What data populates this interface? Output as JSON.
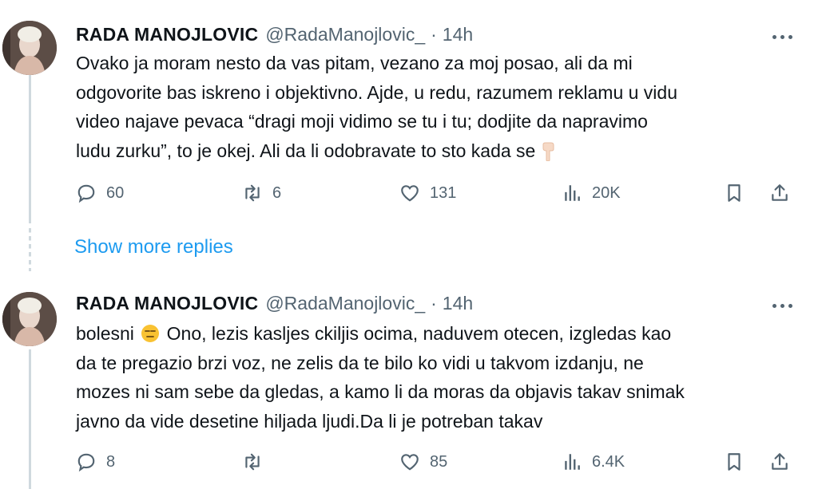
{
  "tweets": [
    {
      "author_name": "RADA MANOJLOVIC",
      "handle": "@RadaManojlovic_",
      "separator": "·",
      "time": "14h",
      "lines": [
        "Ovako ja moram nesto da vas pitam, vezano za moj posao, ali da mi",
        "odgovorite bas iskreno i objektivno. Ajde, u redu, razumem reklamu u vidu",
        "video najave pevaca “dragi moji vidimo se tu i tu; dodjite da napravimo",
        "ludu zurku”, to je okej. Ali da li odobravate to sto kada se"
      ],
      "emoji": "pointing-down",
      "replies": "60",
      "retweets": "6",
      "likes": "131",
      "views": "20K"
    },
    {
      "author_name": "RADA MANOJLOVIC",
      "handle": "@RadaManojlovic_",
      "separator": "·",
      "time": "14h",
      "line1_start": "bolesni",
      "line1_end": "Ono, lezis kasljes ckiljis ocima, naduvem otecen, izgledas kao",
      "lines": [
        "da te pregazio brzi voz, ne zelis da te bilo ko vidi u takvom izdanju, ne",
        "mozes ni sam sebe da gledas, a kamo li da moras da objavis takav snimak",
        "javno da vide desetine hiljada ljudi.Da li je potreban takav"
      ],
      "emoji": "expressionless-face",
      "replies": "8",
      "retweets": "",
      "likes": "85",
      "views": "6.4K"
    }
  ],
  "show_more_replies": "Show more replies",
  "icons": [
    "reply-icon",
    "retweet-icon",
    "like-icon",
    "views-icon",
    "bookmark-icon",
    "share-icon",
    "more-icon"
  ],
  "colors": {
    "link": "#1d9bf0",
    "secondary_text": "#536471",
    "text": "#0f1419",
    "thread_line": "#cfd9de"
  }
}
